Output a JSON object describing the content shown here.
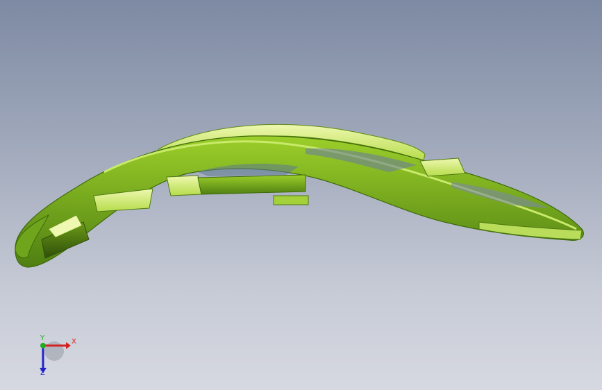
{
  "viewport": {
    "background_top": "#7d8aa3",
    "background_bottom": "#d6d9e1",
    "model": {
      "base_color": "#8dc21f",
      "highlight_color": "#e6f59a",
      "shadow_color": "#3f6a0c"
    }
  },
  "triad": {
    "x_label": "X",
    "y_label": "Y",
    "z_label": "Z",
    "x_color": "#d22222",
    "y_color": "#22aa22",
    "z_color": "#2222cc"
  }
}
